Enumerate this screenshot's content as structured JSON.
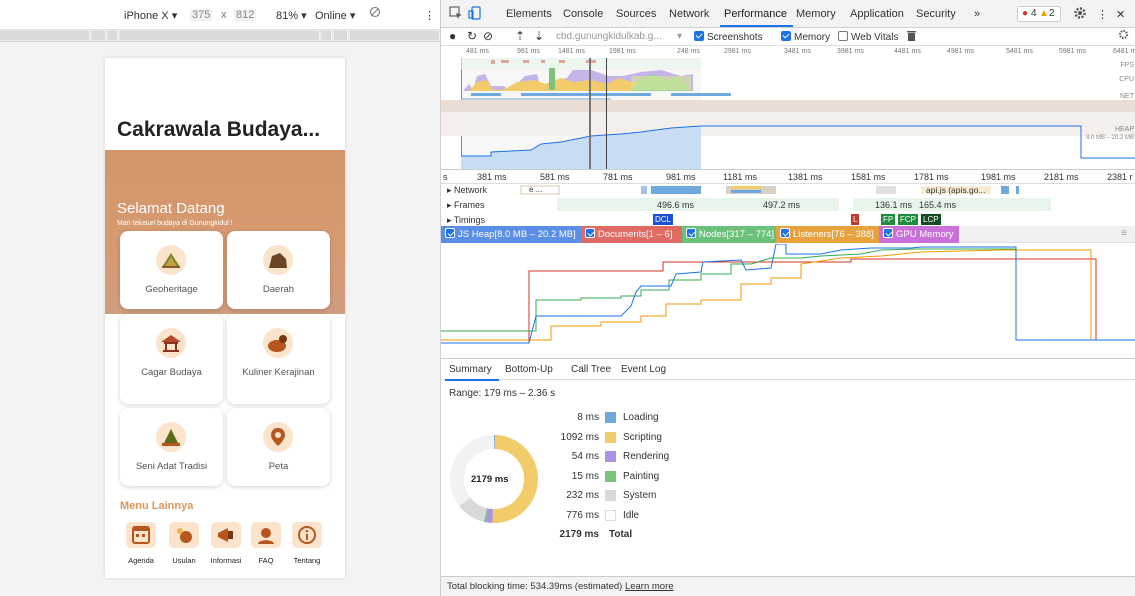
{
  "device_toolbar": {
    "device": "iPhone X ▾",
    "width": "375",
    "times": "x",
    "height": "812",
    "zoom": "81% ▾",
    "network": "Online ▾",
    "more": "⋮"
  },
  "app": {
    "title": "Cakrawala Budaya...",
    "hero_title": "Selamat Datang",
    "hero_subtitle": "Mari telusuri budaya di Gunungkidul !",
    "cards": [
      {
        "label": "Geoheritage",
        "icon": "mountain-icon"
      },
      {
        "label": "Daerah",
        "icon": "hill-icon"
      },
      {
        "label": "Cagar Budaya",
        "icon": "pavilion-icon"
      },
      {
        "label": "Kuliner Kerajinan",
        "icon": "food-icon"
      },
      {
        "label": "Seni Adat Tradisi",
        "icon": "tumpeng-icon"
      },
      {
        "label": "Peta",
        "icon": "map-pin-icon"
      }
    ],
    "menu_title": "Menu Lainnya",
    "menu_items": [
      {
        "label": "Agenda",
        "icon": "calendar-icon"
      },
      {
        "label": "Usulan",
        "icon": "hand-icon"
      },
      {
        "label": "Informasi",
        "icon": "megaphone-icon"
      },
      {
        "label": "FAQ",
        "icon": "support-icon"
      },
      {
        "label": "Tentang",
        "icon": "info-icon"
      }
    ]
  },
  "devtools": {
    "tabs": [
      "Elements",
      "Console",
      "Sources",
      "Network",
      "Performance",
      "Memory",
      "Application",
      "Security",
      "»"
    ],
    "active_tab": "Performance",
    "errors": "4",
    "warnings": "2",
    "url": "cbd.gunungkidulkab.g...",
    "screenshots_label": "Screenshots",
    "memory_label": "Memory",
    "webvitals_label": "Web Vitals",
    "overview_ticks": [
      "481 ms",
      "981 ms",
      "1481 ms",
      "1981 ms",
      "248 ms",
      "2981 ms",
      "3481 ms",
      "3981 ms",
      "4481 ms",
      "4981 ms",
      "5481 ms",
      "5981 ms",
      "6481 ms"
    ],
    "overview_labels": [
      "FPS",
      "CPU",
      "NET",
      "HEAP"
    ],
    "heap_range": "8.0 MB – 20.2 MB",
    "flame_ticks": [
      "s",
      "381 ms",
      "581 ms",
      "781 ms",
      "981 ms",
      "1181 ms",
      "1381 ms",
      "1581 ms",
      "1781 ms",
      "1981 ms",
      "2181 ms",
      "2381 r"
    ],
    "tracks": [
      "▸ Network",
      "▸ Frames",
      "▸ Timings"
    ],
    "network_snippets": [
      "e ...",
      "api.js (apis.go..."
    ],
    "frames": [
      "496.6 ms",
      "497.2 ms",
      "136.1 ms",
      "165.4 ms"
    ],
    "timing_marks": [
      "DCL",
      "L",
      "FP",
      "FCP",
      "LCP"
    ],
    "counters": [
      "JS Heap[8.0 MB – 20.2 MB]",
      "Documents[1 – 6]",
      "Nodes[317 – 774]",
      "Listeners[76 – 388]",
      "GPU Memory"
    ],
    "bottom_tabs": [
      "Summary",
      "Bottom-Up",
      "Call Tree",
      "Event Log"
    ],
    "range": "Range: 179 ms – 2.36 s",
    "donut_center": "2179 ms",
    "summary": [
      {
        "value": "8 ms",
        "name": "Loading",
        "color": "#6fa8dc"
      },
      {
        "value": "1092 ms",
        "name": "Scripting",
        "color": "#f2cc6b"
      },
      {
        "value": "54 ms",
        "name": "Rendering",
        "color": "#a993e4"
      },
      {
        "value": "15 ms",
        "name": "Painting",
        "color": "#7ec17b"
      },
      {
        "value": "232 ms",
        "name": "System",
        "color": "#d9d9d9"
      },
      {
        "value": "776 ms",
        "name": "Idle",
        "color": "#ffffff"
      },
      {
        "value": "2179 ms",
        "name": "Total",
        "color": ""
      }
    ],
    "status_text": "Total blocking time: 534.39ms (estimated)",
    "status_link": "Learn more"
  }
}
